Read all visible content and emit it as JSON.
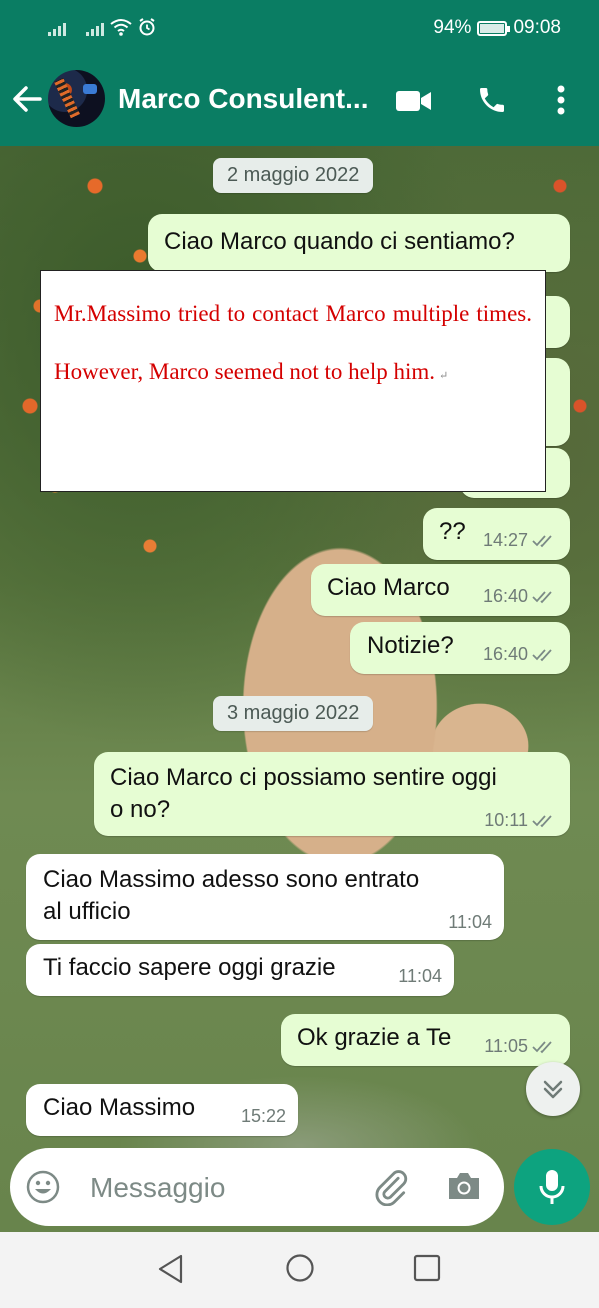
{
  "status_bar": {
    "battery": "94%",
    "time": "09:08"
  },
  "header": {
    "contact_name": "Marco Consulent..."
  },
  "messages": {
    "date1": "2 maggio 2022",
    "m1": {
      "text": "Ciao Marco quando ci sentiamo?"
    },
    "m2": {
      "text": "??",
      "time": "14:27"
    },
    "m3": {
      "text": "Ciao Marco",
      "time": "16:40"
    },
    "m4": {
      "text": "Notizie?",
      "time": "16:40"
    },
    "date2": "3 maggio 2022",
    "m5": {
      "line1": "Ciao Marco ci possiamo sentire oggi",
      "line2": "o no?",
      "time": "10:11"
    },
    "m6": {
      "line1": "Ciao Massimo adesso sono entrato",
      "line2": "al ufficio",
      "time": "11:04"
    },
    "m7": {
      "text": "Ti faccio sapere oggi grazie",
      "time": "11:04"
    },
    "m8": {
      "text": "Ok grazie a Te",
      "time": "11:05"
    },
    "m9": {
      "text": "Ciao Massimo",
      "time": "15:22"
    }
  },
  "annotation": {
    "text": "Mr.Massimo tried to contact Marco multiple times. However, Marco seemed not to help him."
  },
  "input": {
    "placeholder": "Messaggio"
  },
  "colors": {
    "header": "#0a7d63",
    "outgoing_bubble": "#e6fdd3",
    "incoming_bubble": "#ffffff",
    "mic_button": "#0da37f",
    "annotation_text": "#d40000"
  }
}
